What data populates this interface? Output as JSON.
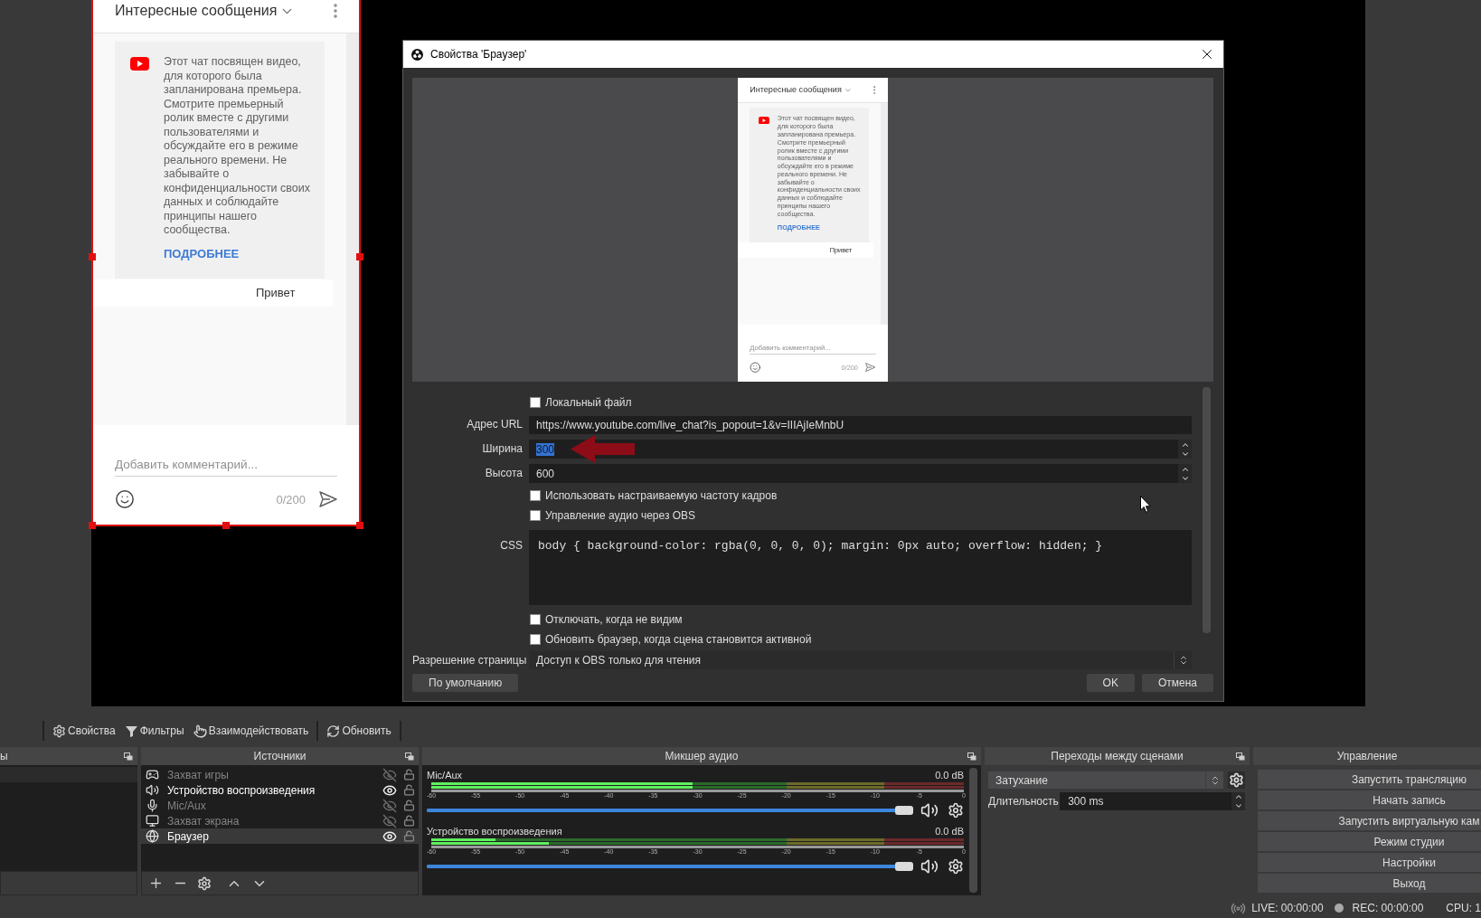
{
  "preview": {
    "source": {
      "selected": true,
      "chat": {
        "title": "Интересные сообщения",
        "notice": "Этот чат посвящен видео, для которого была запланирована премьера. Смотрите премьерный ролик вместе с другими пользователями и обсуждайте его в режиме реального времени. Не забывайте о конфиденциальности своих данных и соблюдайте принципы нашего сообщества.",
        "link": "ПОДРОБНЕЕ",
        "messages": [
          {
            "text": "Привет"
          }
        ],
        "placeholder": "Добавить комментарий...",
        "counter": "0/200"
      }
    }
  },
  "dialog": {
    "title": "Свойства 'Браузер'",
    "preview_chat": {
      "title": "Интересные сообщения",
      "notice": "Этот чат посвящен видео, для которого была запланирована премьера. Смотрите премьерный ролик вместе с другими пользователями и обсуждайте его в режиме реального времени. Не забывайте о конфиденциальности своих данных и соблюдайте принципы нашего сообщества.",
      "link": "ПОДРОБНЕЕ",
      "messages": [
        {
          "text": "Привет"
        }
      ],
      "placeholder": "Добавить комментарий...",
      "counter": "0/200"
    },
    "form": [
      {
        "kind": "checkbox",
        "label": "Локальный файл",
        "checked": false
      },
      {
        "kind": "text",
        "label": "Адрес URL",
        "value": "https://www.youtube.com/live_chat?is_popout=1&v=IIIAjIeMnbU"
      },
      {
        "kind": "spin",
        "label": "Ширина",
        "value": "300",
        "text_selected": true,
        "annotated": true
      },
      {
        "kind": "spin",
        "label": "Высота",
        "value": "600",
        "text_selected": false,
        "annotated": false
      },
      {
        "kind": "checkbox",
        "label": "Использовать настраиваемую частоту кадров",
        "checked": false
      },
      {
        "kind": "checkbox",
        "label": "Управление аудио через OBS",
        "checked": false
      },
      {
        "kind": "textarea",
        "label": "CSS",
        "value": "body { background-color: rgba(0, 0, 0, 0); margin: 0px auto; overflow: hidden; }"
      },
      {
        "kind": "checkbox",
        "label": "Отключать, когда не видим",
        "checked": false
      },
      {
        "kind": "checkbox",
        "label": "Обновить браузер, когда сцена становится активной",
        "checked": false
      },
      {
        "kind": "select",
        "label": "Разрешение страницы",
        "value": "Доступ к OBS только для чтения"
      }
    ],
    "defaults_button": "По умолчанию",
    "buttons": [
      "OK",
      "Отмена"
    ]
  },
  "toolbar": {
    "groups": [
      {
        "buttons": [
          {
            "kind": "properties",
            "label": "Свойства"
          },
          {
            "kind": "filters",
            "label": "Фильтры"
          },
          {
            "kind": "interact",
            "label": "Взаимодействовать"
          }
        ]
      },
      {
        "buttons": [
          {
            "kind": "refresh",
            "label": "Обновить"
          }
        ]
      }
    ]
  },
  "docks": {
    "scenes": {
      "title": "ы",
      "items": [
        {
          "selected": true
        }
      ]
    },
    "sources": {
      "title": "Источники",
      "items": [
        {
          "kind": "game",
          "label": "Захват игры",
          "visible": false,
          "locked": false,
          "selected": false
        },
        {
          "kind": "audio",
          "label": "Устройство воспроизведения",
          "visible": true,
          "locked": false,
          "selected": false
        },
        {
          "kind": "mic",
          "label": "Mic/Aux",
          "visible": false,
          "locked": false,
          "selected": false
        },
        {
          "kind": "display",
          "label": "Захват экрана",
          "visible": false,
          "locked": false,
          "selected": false
        },
        {
          "kind": "browser",
          "label": "Браузер",
          "visible": true,
          "locked": false,
          "selected": true
        }
      ]
    },
    "mixer": {
      "title": "Микшер аудио",
      "channels": [
        {
          "name": "Mic/Aux",
          "reading": "0.0 dB",
          "meters": [
            {
              "level": 0.49
            },
            {
              "level": 0.49
            }
          ],
          "scale": [
            "-60",
            "-55",
            "-50",
            "-45",
            "-40",
            "-35",
            "-30",
            "-25",
            "-20",
            "-15",
            "-10",
            "-5",
            "0"
          ],
          "volume": {
            "level": 1
          },
          "muted": false
        },
        {
          "name": "Устройство воспроизведения",
          "reading": "0.0 dB",
          "meters": [
            {
              "level": 0.12
            },
            {
              "level": 0.22
            }
          ],
          "scale": [
            "-60",
            "-55",
            "-50",
            "-45",
            "-40",
            "-35",
            "-30",
            "-25",
            "-20",
            "-15",
            "-10",
            "-5",
            "0"
          ],
          "volume": {
            "level": 1
          },
          "muted": false
        }
      ]
    },
    "transitions": {
      "title": "Переходы между сценами",
      "transition": "Затухание",
      "duration_label": "Длительность",
      "duration": "300 ms"
    },
    "controls": {
      "title": "Управление",
      "buttons": [
        "Запустить трансляцию",
        "Начать запись",
        "Запустить виртуальную кам",
        "Режим студии",
        "Настройки",
        "Выход"
      ]
    }
  },
  "status_bar": {
    "live": "LIVE: 00:00:00",
    "rec": "REC: 00:00:00",
    "cpu": "CPU: 1"
  }
}
